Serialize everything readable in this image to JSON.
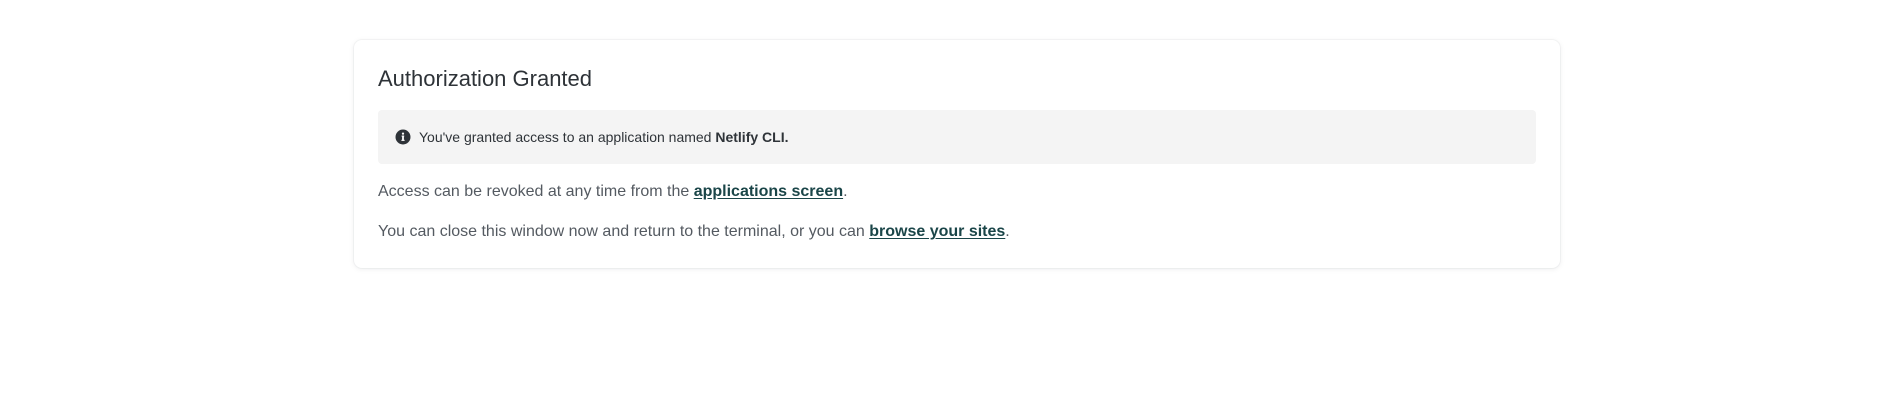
{
  "card": {
    "title": "Authorization Granted",
    "notice": {
      "icon": "info-circle-icon",
      "text_before": "You've granted access to an application named ",
      "app_name": "Netlify CLI",
      "text_after": "."
    },
    "revoke": {
      "text_before": "Access can be revoked at any time from the ",
      "link_label": "applications screen",
      "text_after": "."
    },
    "close": {
      "text_before": "You can close this window now and return to the terminal, or you can ",
      "link_label": "browse your sites",
      "text_after": "."
    }
  },
  "colors": {
    "link": "#1a4548",
    "notice_background": "#f4f4f4",
    "body_text": "#545a61",
    "heading_text": "#2e3338"
  }
}
